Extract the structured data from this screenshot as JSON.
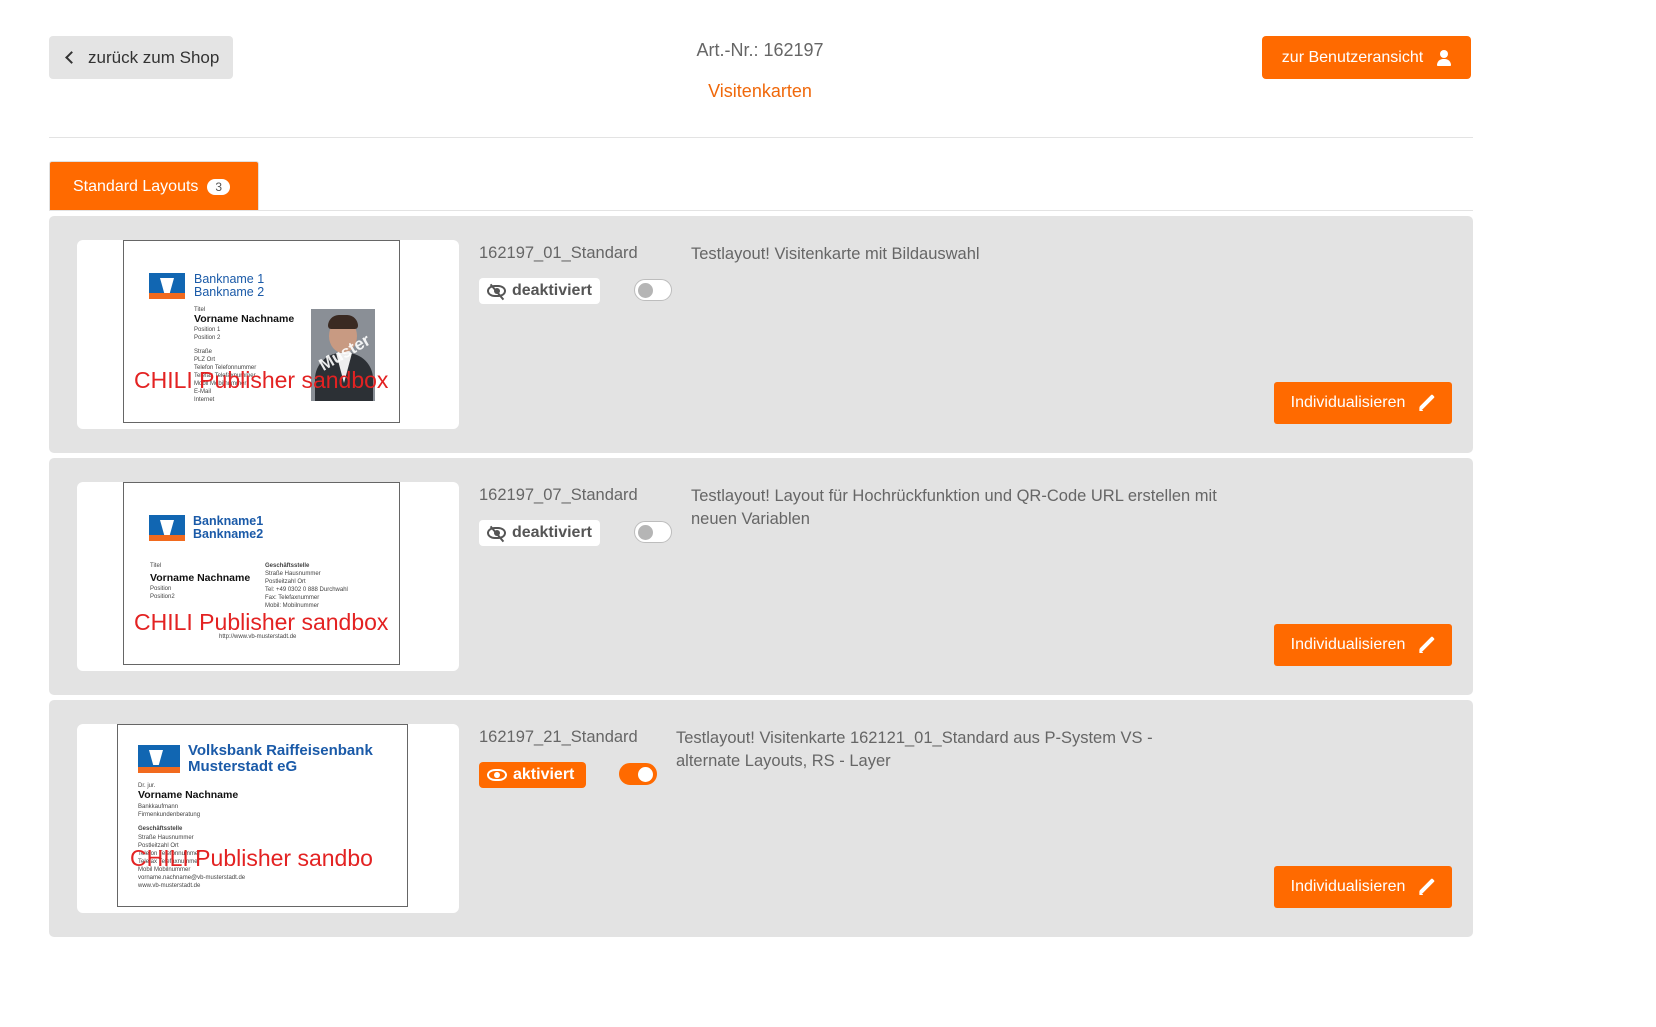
{
  "header": {
    "back_label": "zurück zum Shop",
    "art_nr": "Art.-Nr.: 162197",
    "category": "Visitenkarten",
    "user_view_label": "zur Benutzeransicht"
  },
  "tabs": [
    {
      "label": "Standard Layouts",
      "count": "3"
    }
  ],
  "colors": {
    "accent": "#ff6a00",
    "card_bg": "#e3e3e3",
    "watermark": "#e32222",
    "bank_blue": "#1a5aa8"
  },
  "layouts": [
    {
      "code": "162197_01_Standard",
      "status": "deaktiviert",
      "active": false,
      "description": "Testlayout! Visitenkarte mit Bildauswahl",
      "button": "Individualisieren",
      "preview": {
        "bank_line1": "Bankname 1",
        "bank_line2": "Bankname 2",
        "title_small": "Titel",
        "person_name": "Vorname Nachname",
        "positions": "Position 1\nPosition 2",
        "address": "Straße\nPLZ Ort\nTelefon Telefonnummer\nTelefax Telefaxnummer\nMobil Mobilnummer\nE-Mail\nInternet",
        "photo_watermark": "Muster",
        "watermark": "CHILI Publisher sandbox"
      }
    },
    {
      "code": "162197_07_Standard",
      "status": "deaktiviert",
      "active": false,
      "description": "Testlayout! Layout für Hochrückfunktion und QR-Code URL erstellen mit neuen Variablen",
      "button": "Individualisieren",
      "preview": {
        "bank_line1": "Bankname1",
        "bank_line2": "Bankname2",
        "title_small": "Titel",
        "person_name": "Vorname Nachname",
        "positions": "Position\nPosition2",
        "office_title": "Geschäftsstelle",
        "office_lines": "Straße Hausnummer\nPostleitzahl Ort\nTel: +49 0302 0 888 Durchwahl\nFax: Telefaxnummer\nMobil: Mobilnummer",
        "url": "http://www.vb-musterstadt.de",
        "watermark": "CHILI Publisher sandbox"
      }
    },
    {
      "code": "162197_21_Standard",
      "status": "aktiviert",
      "active": true,
      "description": "Testlayout! Visitenkarte 162121_01_Standard aus P-System VS - alternate Layouts, RS - Layer",
      "button": "Individualisieren",
      "preview": {
        "bank_line1": "Volksbank Raiffeisenbank",
        "bank_line2": "Musterstadt eG",
        "title_small": "Dr. jur.",
        "person_name": "Vorname Nachname",
        "positions": "Bankkaufmann\nFirmenkundenberatung",
        "office_title": "Geschäftsstelle",
        "office_lines": "Straße Hausnummer\nPostleitzahl Ort\nTelefon Telefonnummer\nTelefax Telefaxnummer\nMobil Mobilnummer\nvorname.nachname@vb-musterstadt.de\nwww.vb-musterstadt.de",
        "watermark": "CHILI Publisher sandbo"
      }
    }
  ]
}
